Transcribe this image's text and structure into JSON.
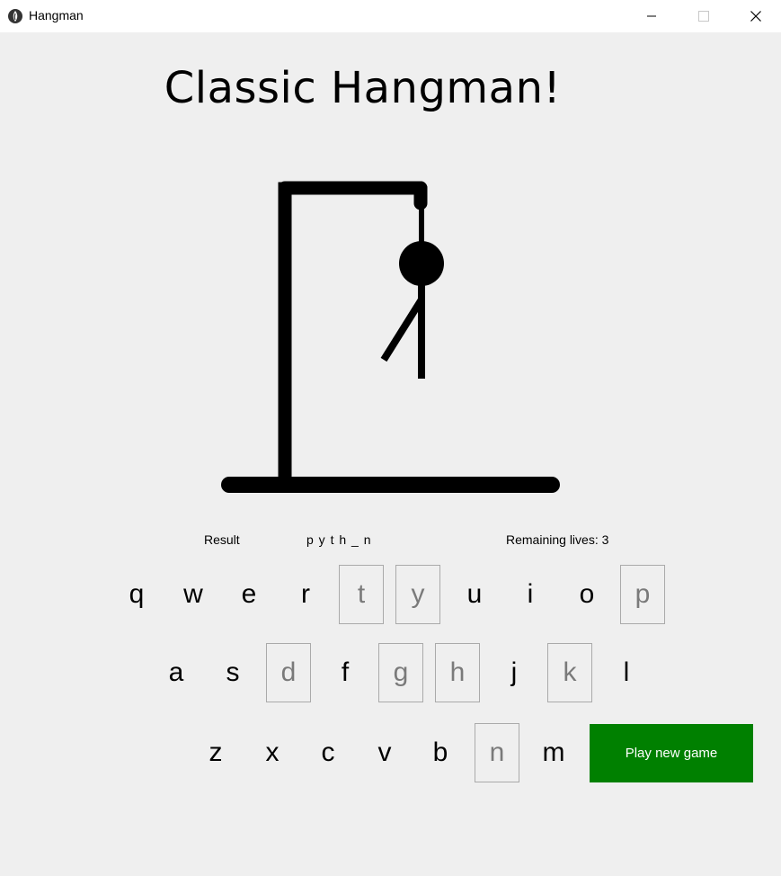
{
  "window": {
    "title": "Hangman",
    "icon": "feather-icon"
  },
  "game": {
    "title": "Classic Hangman!",
    "result_label": "Result",
    "word_display": "p y t h _ n",
    "lives_text": "Remaining lives: 3",
    "play_button_label": "Play new game",
    "play_button_color": "#008000"
  },
  "keyboard": {
    "row1": [
      {
        "letter": "q",
        "used": false
      },
      {
        "letter": "w",
        "used": false
      },
      {
        "letter": "e",
        "used": false
      },
      {
        "letter": "r",
        "used": false
      },
      {
        "letter": "t",
        "used": true
      },
      {
        "letter": "y",
        "used": true
      },
      {
        "letter": "u",
        "used": false
      },
      {
        "letter": "i",
        "used": false
      },
      {
        "letter": "o",
        "used": false
      },
      {
        "letter": "p",
        "used": true
      }
    ],
    "row2": [
      {
        "letter": "a",
        "used": false
      },
      {
        "letter": "s",
        "used": false
      },
      {
        "letter": "d",
        "used": true
      },
      {
        "letter": "f",
        "used": false
      },
      {
        "letter": "g",
        "used": true
      },
      {
        "letter": "h",
        "used": true
      },
      {
        "letter": "j",
        "used": false
      },
      {
        "letter": "k",
        "used": true
      },
      {
        "letter": "l",
        "used": false
      }
    ],
    "row3": [
      {
        "letter": "z",
        "used": false
      },
      {
        "letter": "x",
        "used": false
      },
      {
        "letter": "c",
        "used": false
      },
      {
        "letter": "v",
        "used": false
      },
      {
        "letter": "b",
        "used": false
      },
      {
        "letter": "n",
        "used": true
      },
      {
        "letter": "m",
        "used": false
      }
    ]
  }
}
